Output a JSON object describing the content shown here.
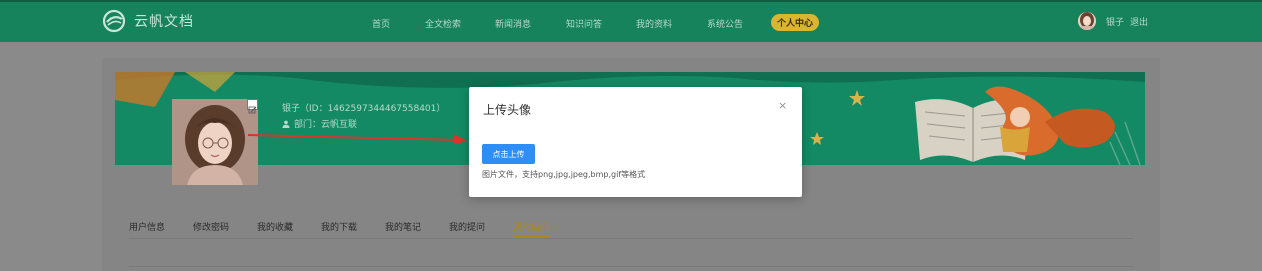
{
  "header": {
    "logo_text": "云帆文档",
    "nav": [
      {
        "label": "首页"
      },
      {
        "label": "全文检索"
      },
      {
        "label": "新闻消息"
      },
      {
        "label": "知识问答"
      },
      {
        "label": "我的资料"
      },
      {
        "label": "系统公告"
      },
      {
        "label": "个人中心",
        "active": true
      }
    ],
    "user_name": "银子",
    "logout_label": "退出"
  },
  "profile": {
    "name_line": "银子（ID：1462597344467558401）",
    "dept_line": "部门：云帆互联"
  },
  "tabs": [
    {
      "label": "用户信息"
    },
    {
      "label": "修改密码"
    },
    {
      "label": "我的收藏"
    },
    {
      "label": "我的下载"
    },
    {
      "label": "我的笔记"
    },
    {
      "label": "我的提问"
    },
    {
      "label": "我的借阅",
      "active": true
    }
  ],
  "modal": {
    "title": "上传头像",
    "close_symbol": "×",
    "upload_button": "点击上传",
    "hint": "图片文件，支持png,jpg,jpeg,bmp,gif等格式"
  },
  "colors": {
    "brand_green": "#16835d",
    "accent_gold": "#d8b630",
    "primary_blue": "#2e8ef6",
    "arrow_red": "#d9352b"
  }
}
